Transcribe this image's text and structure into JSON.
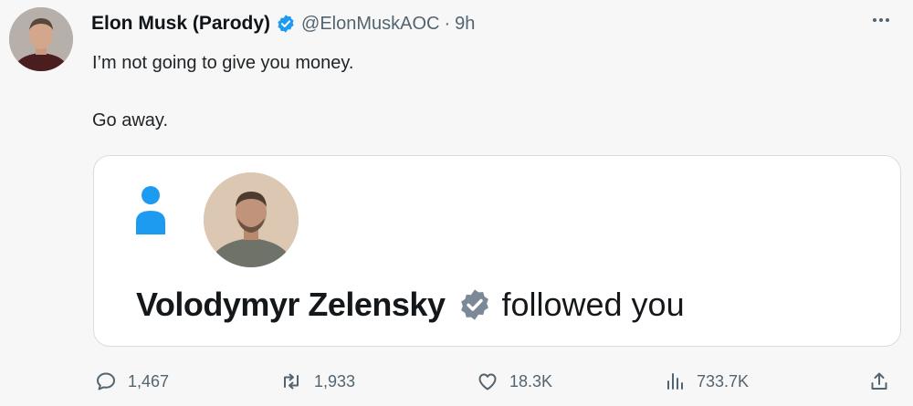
{
  "tweet": {
    "author_name": "Elon Musk (Parody)",
    "handle": "@ElonMuskAOC",
    "separator": "·",
    "time": "9h",
    "lines": [
      "I’m not going to give you money.",
      "Go away."
    ]
  },
  "card": {
    "follower_name": "Volodymyr Zelensky",
    "action_text": "followed you"
  },
  "actions": {
    "replies": "1,467",
    "retweets": "1,933",
    "likes": "18.3K",
    "views": "733.7K"
  },
  "colors": {
    "verified_blue": "#1d9bf0",
    "gray_badge": "#7b8996",
    "icon_blue": "#1d9bf0",
    "muted_text": "#536471"
  },
  "icons": [
    "verified-badge-icon",
    "more-icon",
    "person-icon",
    "gray-verified-badge-icon",
    "reply-icon",
    "retweet-icon",
    "like-icon",
    "views-icon",
    "share-icon"
  ]
}
